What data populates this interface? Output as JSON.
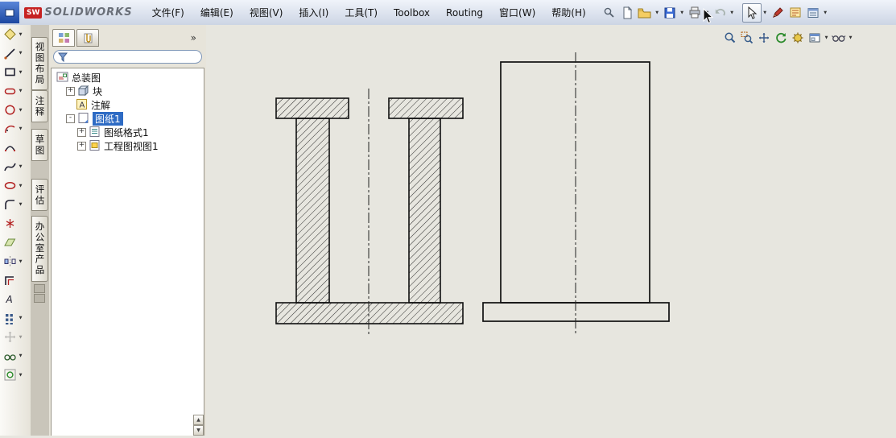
{
  "titlebar": {
    "logo_badge": "SW",
    "logo_text": "SOLIDWORKS"
  },
  "menubar": {
    "items": [
      "文件(F)",
      "编辑(E)",
      "视图(V)",
      "插入(I)",
      "工具(T)",
      "Toolbox",
      "Routing",
      "窗口(W)",
      "帮助(H)"
    ]
  },
  "side_tabs": {
    "items": [
      "视图布局",
      "注释",
      "草图",
      "评估",
      "办公室产品"
    ]
  },
  "panel": {
    "overflow_chevron": "»",
    "tree": {
      "root": "总装图",
      "block": "块",
      "annotations": "注解",
      "sheet": "图纸1",
      "sheet_format": "图纸格式1",
      "drawing_view": "工程图视图1"
    }
  },
  "glyphs": {
    "dropdown": "▼",
    "scroll_up": "▲",
    "scroll_down": "▼",
    "expand": "+",
    "collapse": "-",
    "annotation_letter": "A"
  },
  "colors": {
    "selection": "#2e6bc4",
    "canvas_bg": "#e7e6df",
    "hatch_line": "#151515"
  }
}
